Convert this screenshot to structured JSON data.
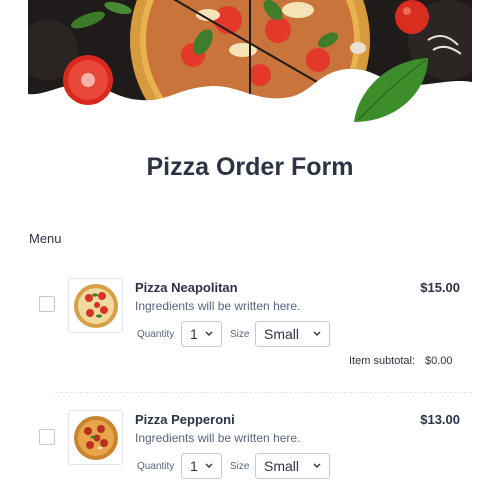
{
  "form": {
    "title": "Pizza Order Form",
    "section_label": "Menu"
  },
  "products": [
    {
      "name": "Pizza Neapolitan",
      "description": "Ingredients will be written here.",
      "price": "$15.00",
      "quantity_label": "Quantity",
      "quantity_value": "1",
      "size_label": "Size",
      "size_value": "Small",
      "subtotal_label": "Item subtotal:",
      "subtotal_value": "$0.00",
      "checked": false
    },
    {
      "name": "Pizza Pepperoni",
      "description": "Ingredients will be written here.",
      "price": "$13.00",
      "quantity_label": "Quantity",
      "quantity_value": "1",
      "size_label": "Size",
      "size_value": "Small",
      "checked": false
    }
  ],
  "colors": {
    "text": "#2c3345",
    "muted": "#57647e",
    "border": "#c3cad8"
  }
}
